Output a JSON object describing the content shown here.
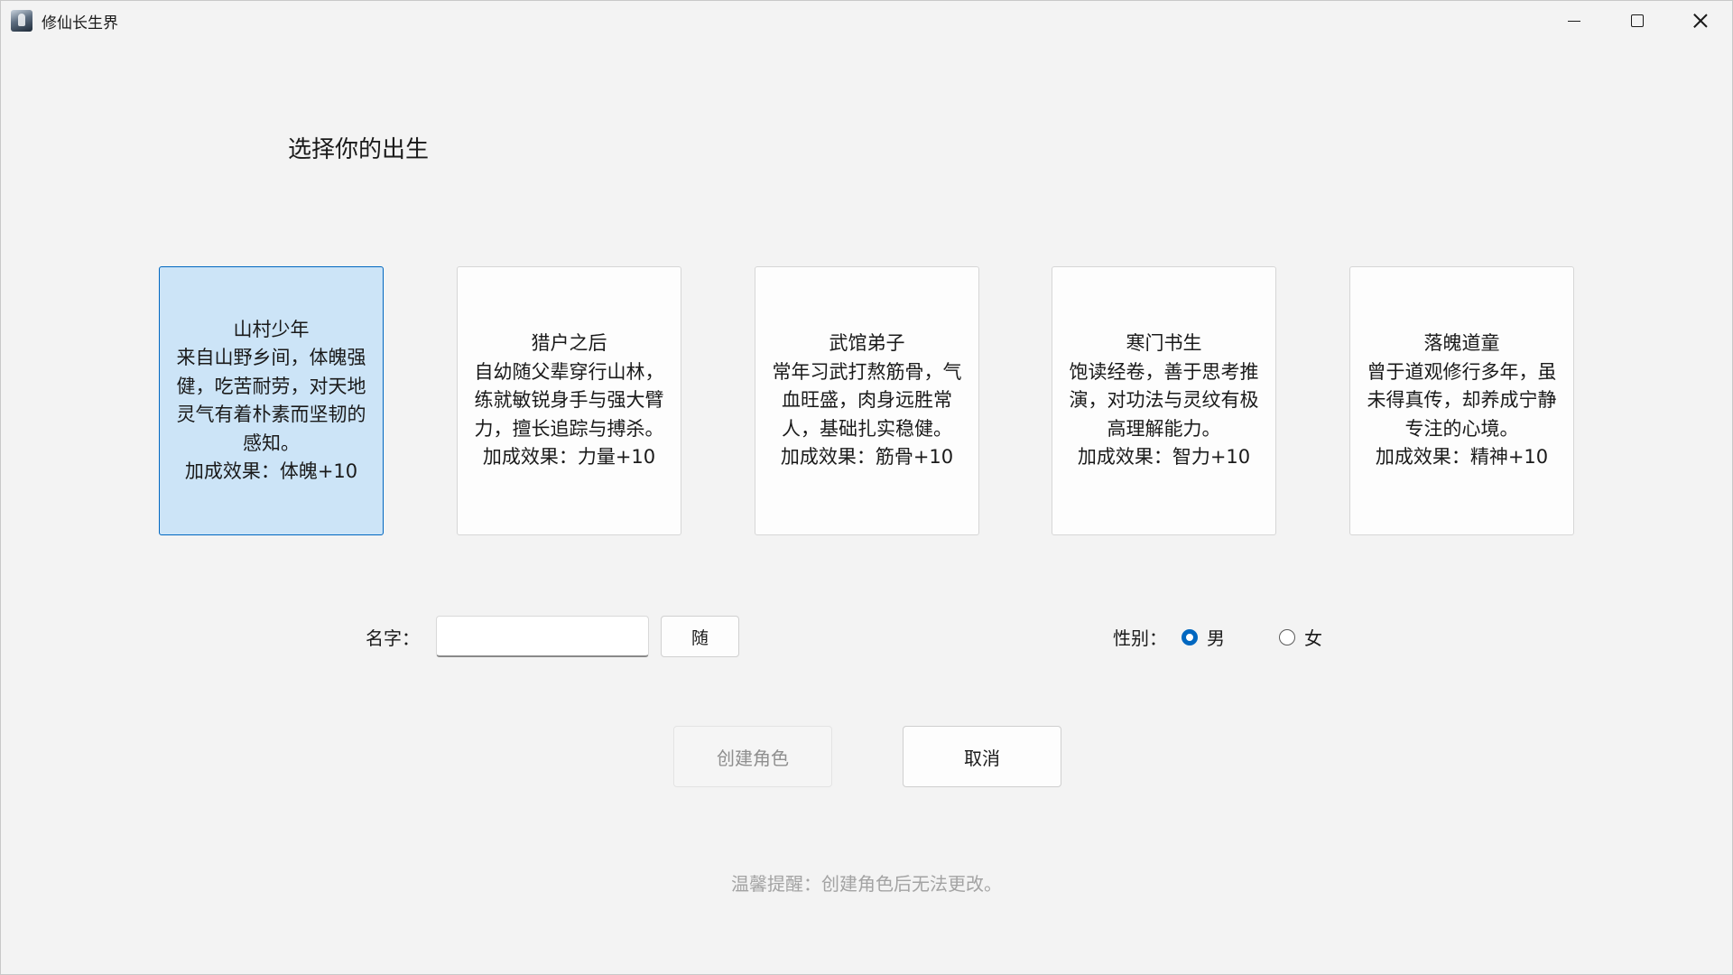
{
  "window": {
    "title": "修仙长生界",
    "controls": [
      "minimize-icon",
      "maximize-icon",
      "close-icon"
    ]
  },
  "main": {
    "heading": "选择你的出生",
    "origins": [
      {
        "title": "山村少年",
        "desc": "来自山野乡间，体魄强健，吃苦耐劳，对天地灵气有着朴素而坚韧的感知。",
        "bonus": "加成效果：体魄+10",
        "selected": true
      },
      {
        "title": "猎户之后",
        "desc": "自幼随父辈穿行山林，练就敏锐身手与强大臂力，擅长追踪与搏杀。",
        "bonus": "加成效果：力量+10",
        "selected": false
      },
      {
        "title": "武馆弟子",
        "desc": "常年习武打熬筋骨，气血旺盛，肉身远胜常人，基础扎实稳健。",
        "bonus": "加成效果：筋骨+10",
        "selected": false
      },
      {
        "title": "寒门书生",
        "desc": "饱读经卷，善于思考推演，对功法与灵纹有极高理解能力。",
        "bonus": "加成效果：智力+10",
        "selected": false
      },
      {
        "title": "落魄道童",
        "desc": "曾于道观修行多年，虽未得真传，却养成宁静专注的心境。",
        "bonus": "加成效果：精神+10",
        "selected": false
      }
    ],
    "name_label": "名字：",
    "name_value": "",
    "random_label": "随",
    "gender_label": "性别：",
    "gender_options": [
      "男",
      "女"
    ],
    "gender_selected": "男",
    "create_label": "创建角色",
    "cancel_label": "取消",
    "tip": "温馨提醒：创建角色后无法更改。"
  },
  "colors": {
    "accent": "#0067c0",
    "selected_card_bg": "#cce4f7",
    "disabled_text": "#8f8f8f",
    "tip_text": "#a3a3a3"
  }
}
